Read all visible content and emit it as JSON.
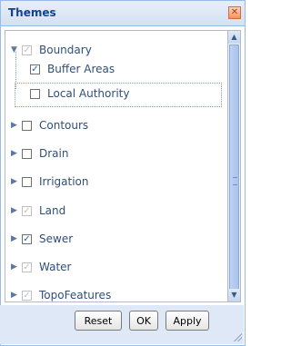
{
  "window": {
    "title": "Themes",
    "close_icon": "close-icon"
  },
  "tree": {
    "items": [
      {
        "label": "Boundary",
        "checked": true,
        "disabled": true,
        "expanded": true,
        "level": 0
      },
      {
        "label": "Buffer Areas",
        "checked": true,
        "disabled": false,
        "level": 1
      },
      {
        "label": "Local Authority",
        "checked": false,
        "disabled": false,
        "level": 1,
        "focused": true
      },
      {
        "label": "Contours",
        "checked": false,
        "disabled": false,
        "expanded": false,
        "level": 0
      },
      {
        "label": "Drain",
        "checked": false,
        "disabled": false,
        "expanded": false,
        "level": 0
      },
      {
        "label": "Irrigation",
        "checked": false,
        "disabled": false,
        "expanded": false,
        "level": 0
      },
      {
        "label": "Land",
        "checked": true,
        "disabled": true,
        "expanded": false,
        "level": 0
      },
      {
        "label": "Sewer",
        "checked": true,
        "disabled": false,
        "expanded": false,
        "level": 0
      },
      {
        "label": "Water",
        "checked": true,
        "disabled": true,
        "expanded": false,
        "level": 0
      },
      {
        "label": "TopoFeatures",
        "checked": true,
        "disabled": true,
        "expanded": false,
        "level": 0
      }
    ]
  },
  "footer": {
    "reset_label": "Reset",
    "ok_label": "OK",
    "apply_label": "Apply"
  },
  "colors": {
    "header_text": "#15428b",
    "item_text": "#2f4f78",
    "accent": "#99bbe8"
  }
}
